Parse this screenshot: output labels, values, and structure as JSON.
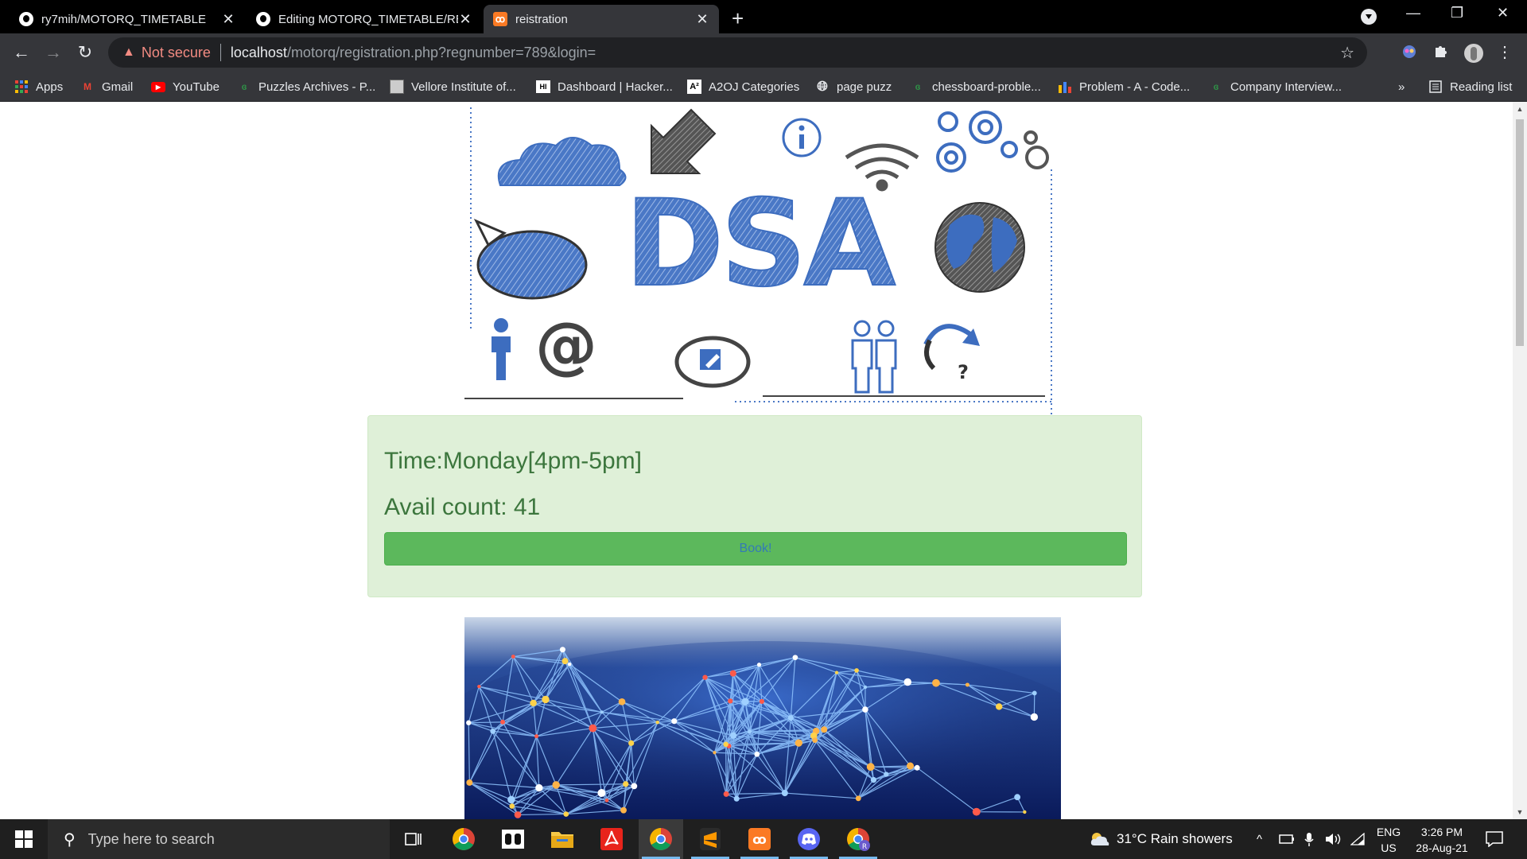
{
  "browser": {
    "tabs": [
      {
        "title": "ry7mih/MOTORQ_TIMETABLE",
        "icon": "github-icon",
        "active": false
      },
      {
        "title": "Editing MOTORQ_TIMETABLE/RE",
        "icon": "github-icon",
        "active": false
      },
      {
        "title": "reistration",
        "icon": "xampp-icon",
        "active": true
      }
    ],
    "address": {
      "security_label": "Not secure",
      "host": "localhost",
      "path": "/motorq/registration.php?regnumber=789&login="
    },
    "bookmarks": [
      {
        "label": "Apps",
        "icon": "apps-grid-icon"
      },
      {
        "label": "Gmail",
        "icon": "gmail-icon"
      },
      {
        "label": "YouTube",
        "icon": "youtube-icon"
      },
      {
        "label": "Puzzles Archives - P...",
        "icon": "gfg-icon"
      },
      {
        "label": "Vellore Institute of...",
        "icon": "vit-icon"
      },
      {
        "label": "Dashboard | Hacker...",
        "icon": "hackerrank-icon"
      },
      {
        "label": "A2OJ Categories",
        "icon": "a2oj-icon"
      },
      {
        "label": "page puzz",
        "icon": "globe-icon"
      },
      {
        "label": "chessboard-proble...",
        "icon": "gfg-icon"
      },
      {
        "label": "Problem - A - Code...",
        "icon": "codeforces-icon"
      },
      {
        "label": "Company Interview...",
        "icon": "gfg-icon"
      }
    ],
    "more_bookmarks": "»",
    "reading_list": "Reading list"
  },
  "page": {
    "hero_text": "DSA",
    "slot": {
      "time_text": "Time:Monday[4pm-5pm]",
      "avail_text": "Avail count: 41",
      "book_label": "Book!"
    }
  },
  "taskbar": {
    "search_placeholder": "Type here to search",
    "weather": "31°C  Rain showers",
    "lang_top": "ENG",
    "lang_bottom": "US",
    "time": "3:26 PM",
    "date": "28-Aug-21"
  },
  "colors": {
    "alert_bg": "#dff0d8",
    "alert_text": "#3c763d",
    "button_bg": "#5cb85c",
    "button_text": "#337ab7",
    "dsa_blue": "#3d6dbf"
  }
}
